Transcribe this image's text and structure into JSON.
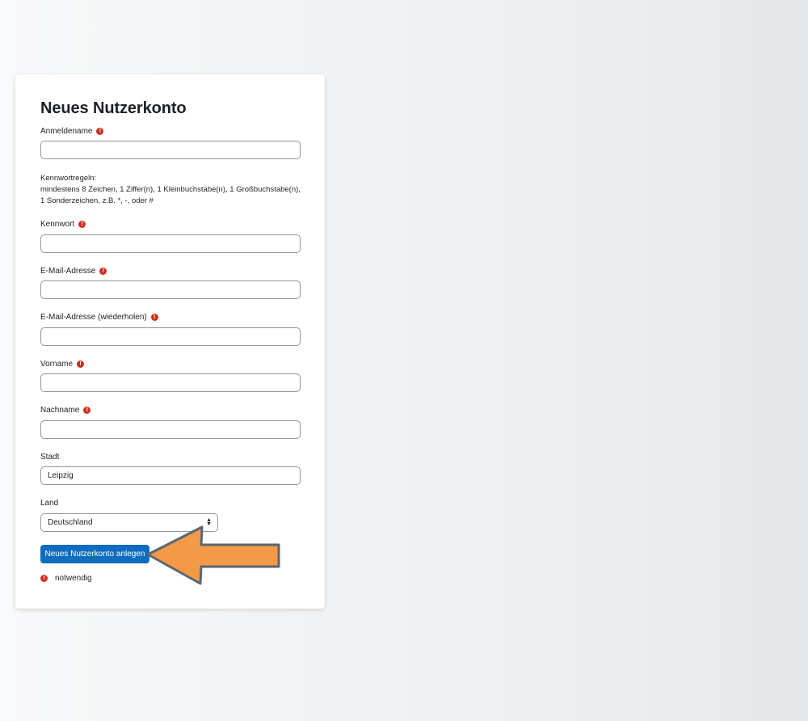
{
  "form": {
    "title": "Neues Nutzerkonto",
    "username_label": "Anmeldename",
    "password_rules_heading": "Kennwortregeln:",
    "password_rules_line1": "mindestens 8 Zeichen, 1 Ziffer(n), 1 Kleinbuchstabe(n), 1 Großbuchstabe(n),",
    "password_rules_line2": "1 Sonderzeichen, z.B. *, -, oder #",
    "password_label": "Kennwort",
    "email_label": "E-Mail-Adresse",
    "email_repeat_label": "E-Mail-Adresse (wiederholen)",
    "firstname_label": "Vorname",
    "lastname_label": "Nachname",
    "city_label": "Stadt",
    "city_value": "Leipzig",
    "country_label": "Land",
    "country_value": "Deutschland",
    "submit_label": "Neues Nutzerkonto anlegen",
    "required_note": "notwendig",
    "required_icon": "exclamation-circle-icon"
  },
  "colors": {
    "primary_button": "#0f6cbf",
    "required_icon": "#ca3120",
    "arrow_fill": "#f29a48",
    "arrow_stroke": "#5d6670"
  }
}
